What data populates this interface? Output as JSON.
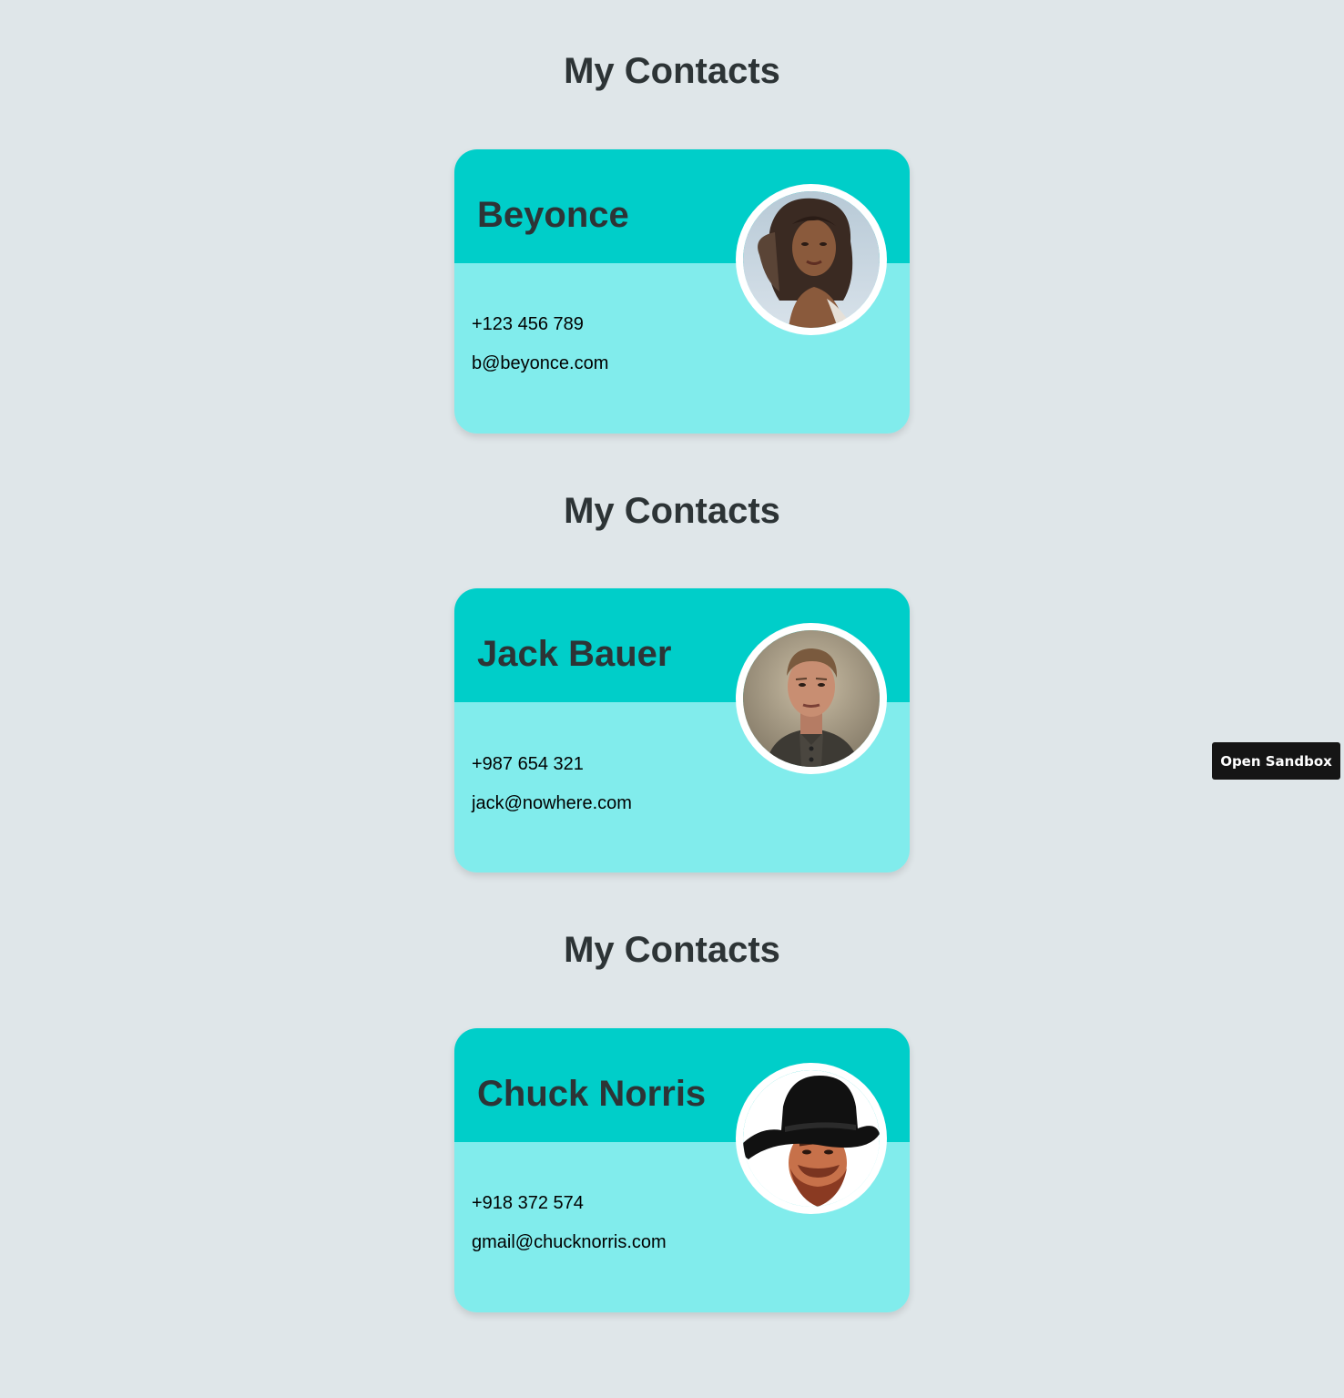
{
  "contacts": [
    {
      "heading": "My Contacts",
      "name": "Beyonce",
      "phone": "+123 456 789",
      "email": "b@beyonce.com",
      "avatar": "portrait-woman-long-hair"
    },
    {
      "heading": "My Contacts",
      "name": "Jack Bauer",
      "phone": "+987 654 321",
      "email": "jack@nowhere.com",
      "avatar": "portrait-man-short-hair"
    },
    {
      "heading": "My Contacts",
      "name": "Chuck Norris",
      "phone": "+918 372 574",
      "email": "gmail@chucknorris.com",
      "avatar": "portrait-man-cowboy-hat"
    }
  ],
  "sandbox_button": {
    "label": "Open Sandbox"
  },
  "colors": {
    "background": "#dfe6e9",
    "card_top": "#00cec9",
    "card_bottom": "#81ecec",
    "heading_text": "#2d3436"
  }
}
